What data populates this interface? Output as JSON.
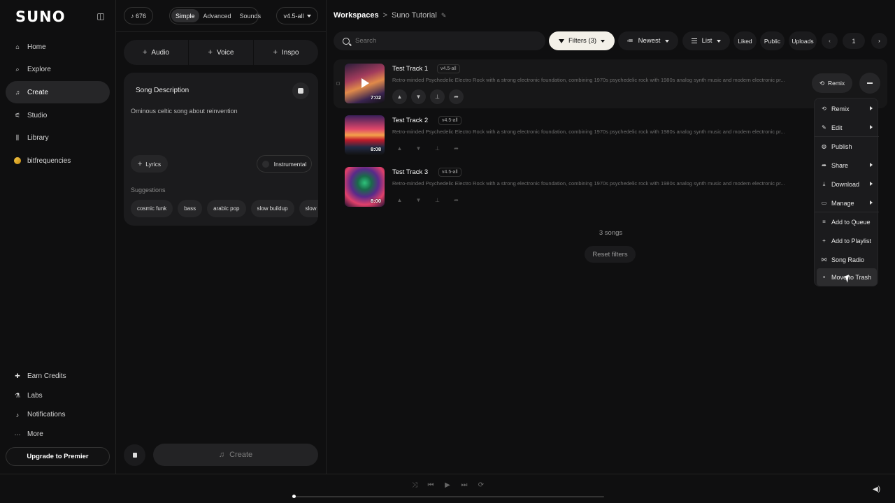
{
  "sidebar": {
    "logo": "SUNO",
    "items": [
      {
        "label": "Home",
        "icon": "home-icon",
        "glyph": "⌂"
      },
      {
        "label": "Explore",
        "icon": "search-icon",
        "glyph": "⌕"
      },
      {
        "label": "Create",
        "icon": "music-note-icon",
        "glyph": "♫"
      },
      {
        "label": "Studio",
        "icon": "sliders-icon",
        "glyph": "⚟"
      },
      {
        "label": "Library",
        "icon": "library-icon",
        "glyph": "⫼"
      },
      {
        "label": "bitfrequencies",
        "icon": "avatar-icon",
        "glyph": ""
      }
    ],
    "bottom_items": [
      {
        "label": "Earn Credits",
        "icon": "gift-icon",
        "glyph": "🎁"
      },
      {
        "label": "Labs",
        "icon": "flask-icon",
        "glyph": "⚗"
      },
      {
        "label": "Notifications",
        "icon": "bell-icon",
        "glyph": "🔔"
      },
      {
        "label": "More",
        "icon": "ellipsis-icon",
        "glyph": "···"
      }
    ],
    "upgrade_label": "Upgrade to Premier"
  },
  "create_panel": {
    "credits": "676",
    "modes": [
      "Simple",
      "Advanced",
      "Sounds"
    ],
    "active_mode": "Simple",
    "version": "v4.5-all",
    "tabs": [
      "Audio",
      "Voice",
      "Inspo"
    ],
    "song_description_label": "Song Description",
    "song_description_value": "Ominous celtic song about reinvention",
    "lyrics_label": "Lyrics",
    "instrumental_label": "Instrumental",
    "suggestions_label": "Suggestions",
    "suggestions": [
      "cosmic funk",
      "bass",
      "arabic pop",
      "slow buildup",
      "slow rap"
    ],
    "create_label": "Create"
  },
  "main": {
    "breadcrumb_root": "Workspaces",
    "breadcrumb_separator": ">",
    "breadcrumb_current": "Suno Tutorial",
    "search_placeholder": "Search",
    "filters_label": "Filters (3)",
    "sort_label": "Newest",
    "view_label": "List",
    "quick_filters": [
      "Liked",
      "Public",
      "Uploads"
    ],
    "page": "1",
    "tracks": [
      {
        "title": "Test Track 1",
        "version": "v4.5-all",
        "duration": "7:02",
        "description": "Retro-minded Psychedelic Electro Rock with a strong electronic foundation, combining 1970s psychedelic rock with 1980s analog synth music and modern electronic pr..."
      },
      {
        "title": "Test Track 2",
        "version": "v4.5-all",
        "duration": "8:08",
        "description": "Retro-minded Psychedelic Electro Rock with a strong electronic foundation, combining 1970s psychedelic rock with 1980s analog synth music and modern electronic pr..."
      },
      {
        "title": "Test Track 3",
        "version": "v4.5-all",
        "duration": "8:00",
        "description": "Retro-minded Psychedelic Electro Rock with a strong electronic foundation, combining 1970s psychedelic rock with 1980s analog synth music and modern electronic pr..."
      }
    ],
    "remix_label": "Remix",
    "songs_count": "3 songs",
    "reset_filters_label": "Reset filters"
  },
  "context_menu": {
    "items": [
      {
        "label": "Remix",
        "icon": "remix-icon",
        "glyph": "⟲",
        "submenu": true
      },
      {
        "label": "Edit",
        "icon": "pencil-icon",
        "glyph": "✎",
        "submenu": true
      },
      {
        "label": "Publish",
        "icon": "globe-icon",
        "glyph": "◍",
        "submenu": false
      },
      {
        "label": "Share",
        "icon": "share-icon",
        "glyph": "➦",
        "submenu": true
      },
      {
        "label": "Download",
        "icon": "download-icon",
        "glyph": "⤓",
        "submenu": true
      },
      {
        "label": "Manage",
        "icon": "manage-icon",
        "glyph": "▭",
        "submenu": true
      },
      {
        "label": "Add to Queue",
        "icon": "queue-icon",
        "glyph": "≡",
        "submenu": false
      },
      {
        "label": "Add to Playlist",
        "icon": "plus-icon",
        "glyph": "+",
        "submenu": false
      },
      {
        "label": "Song Radio",
        "icon": "radio-icon",
        "glyph": "⋈",
        "submenu": false
      },
      {
        "label": "Move to Trash",
        "icon": "trash-icon",
        "glyph": "🗑",
        "submenu": false
      }
    ]
  },
  "player": {
    "progress": 0
  },
  "colors": {
    "background": "#0f0f10",
    "panel": "#1b1b1d",
    "filters_active": "#f3f0e8"
  }
}
